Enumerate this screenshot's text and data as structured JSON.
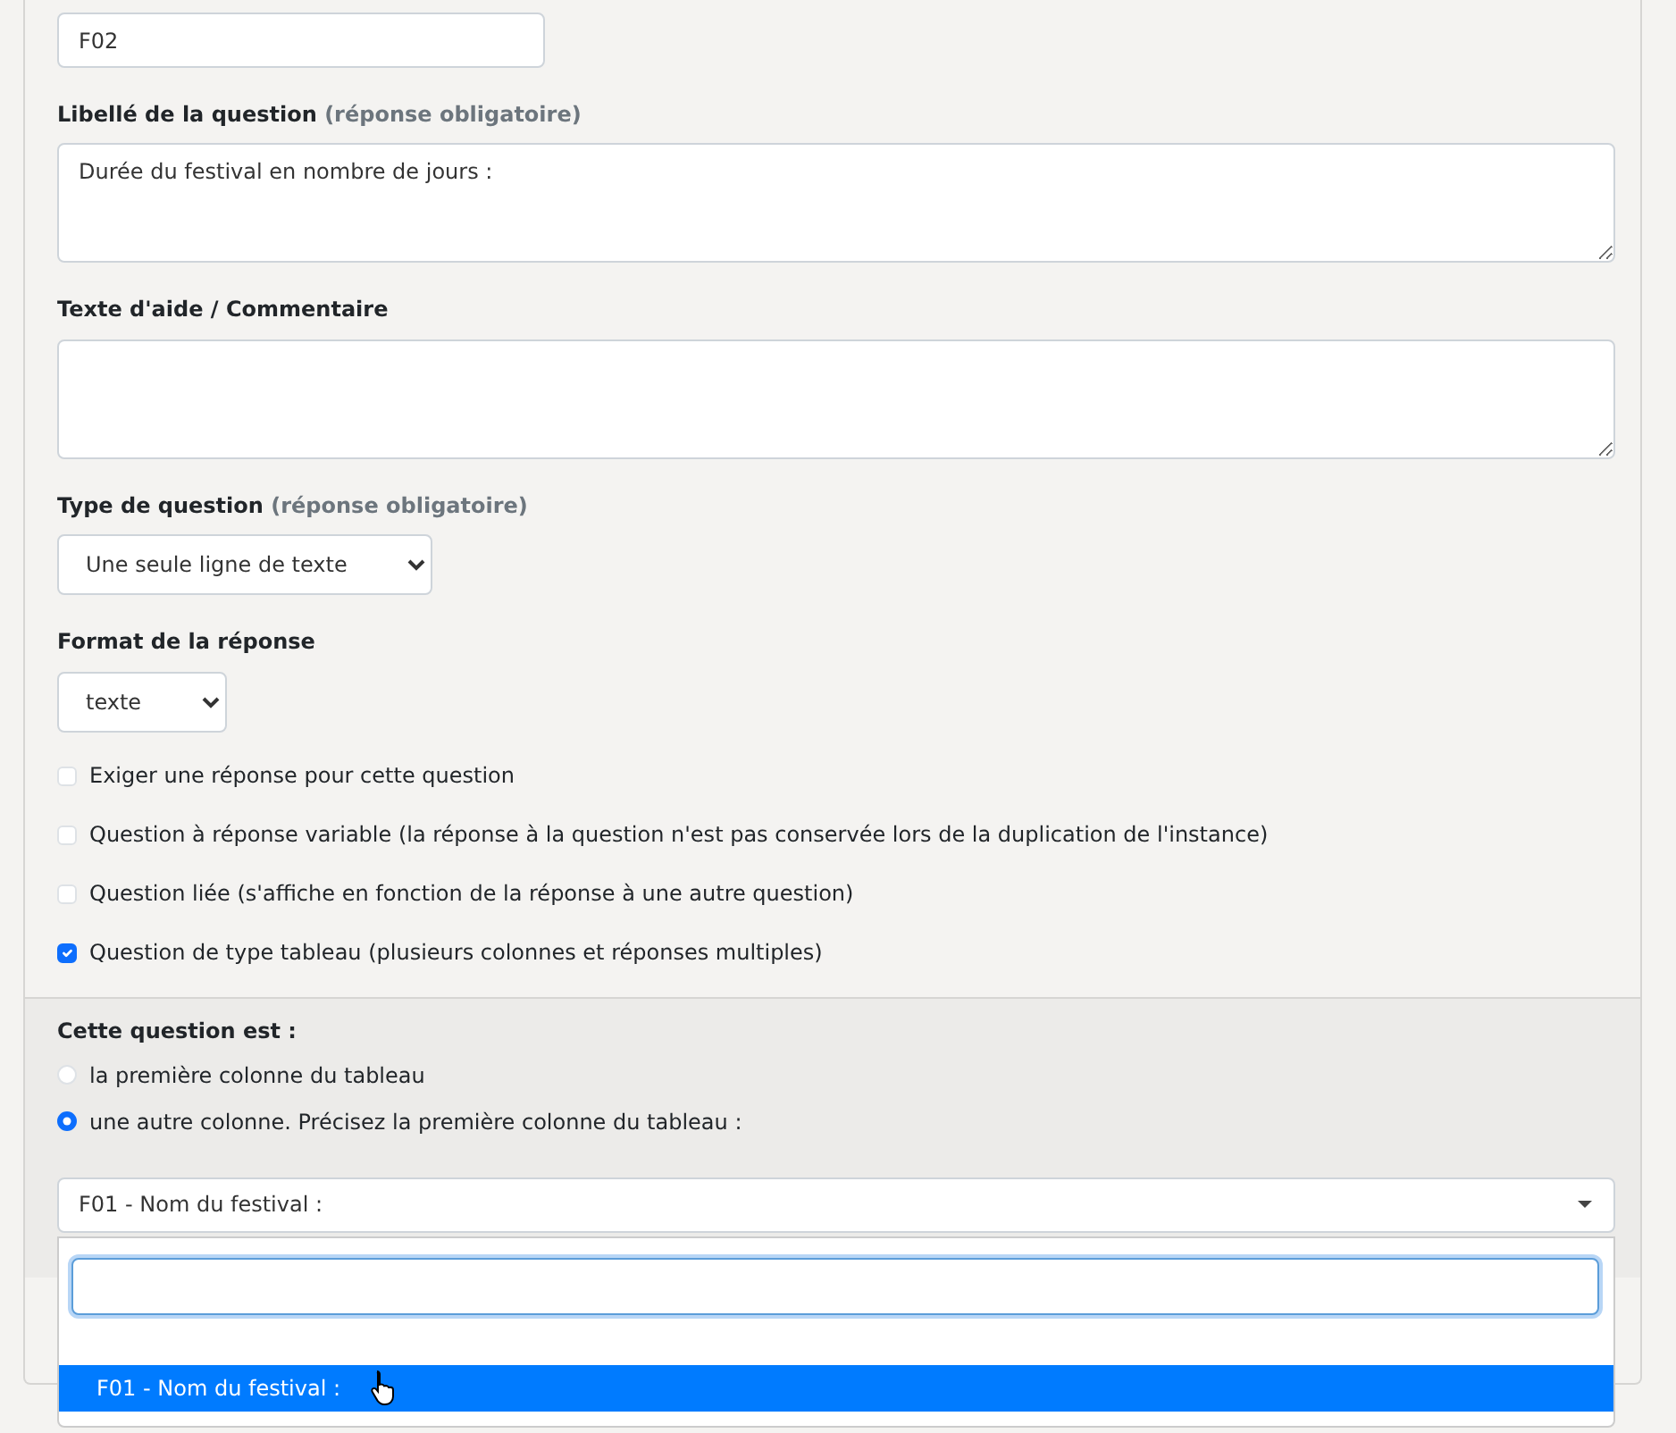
{
  "code_field": {
    "value": "F02"
  },
  "fields": [
    {
      "label": "Libellé de la question",
      "note": "(réponse obligatoire)",
      "kind": "textarea",
      "value": "Durée du festival en nombre de jours :"
    },
    {
      "label": "Texte d'aide / Commentaire",
      "kind": "textarea"
    },
    {
      "label": "Type de question",
      "note": "(réponse obligatoire)",
      "kind": "select",
      "value": "Une seule ligne de texte"
    },
    {
      "label": "Format de la réponse",
      "kind": "select",
      "value": "texte"
    }
  ],
  "checkboxes": [
    {
      "label": "Exiger une réponse pour cette question",
      "checked": false
    },
    {
      "label": "Question à réponse variable (la réponse à la question n'est pas conservée lors de la duplication de l'instance)",
      "checked": false
    },
    {
      "label": "Question liée (s'affiche en fonction de la réponse à une autre question)",
      "checked": false
    },
    {
      "label": "Question de type tableau (plusieurs colonnes et réponses multiples)",
      "checked": true
    }
  ],
  "column_section": {
    "title": "Cette question est :",
    "radios": [
      {
        "label": "la première colonne du tableau",
        "selected": false
      },
      {
        "label": "une autre colonne. Précisez la première colonne du tableau :",
        "selected": true
      }
    ],
    "select": {
      "value": "F01 - Nom du festival :",
      "expanded": true,
      "options": [
        {
          "label": "F01 - Nom du festival :",
          "selected": true
        }
      ]
    }
  }
}
